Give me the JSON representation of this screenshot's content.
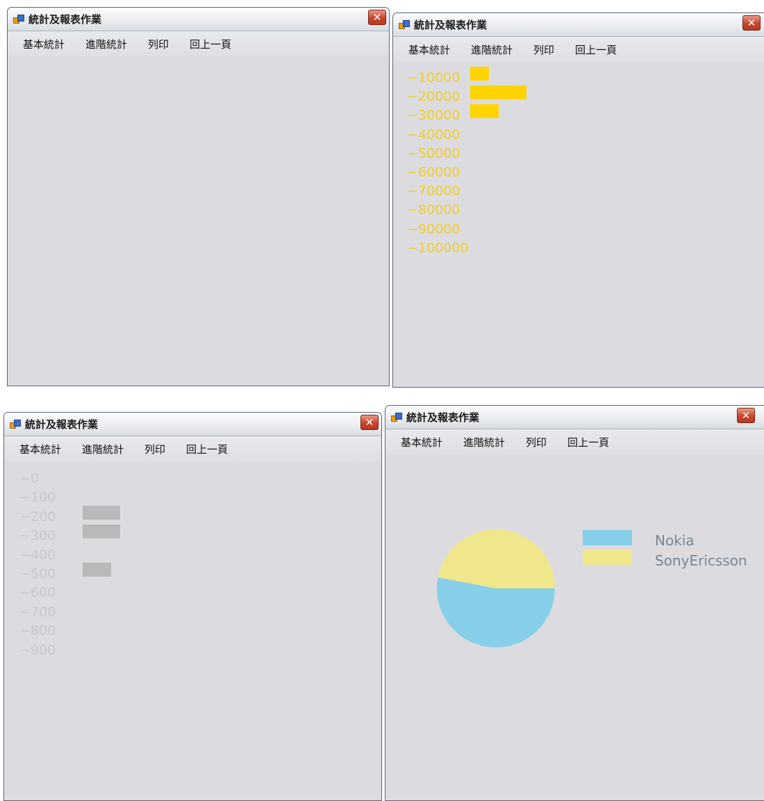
{
  "colors": {
    "yellow_bar": "#ffd400",
    "yellow_label": "#f2cc2a",
    "gray_bar": "#b9b9bb",
    "gray_label": "#c8c8cc",
    "nokia": "#87cfe9",
    "sonyericsson": "#f0e68c",
    "window_bg": "#dcdce0"
  },
  "windows": [
    {
      "title": "統計及報表作業",
      "close_glyph": "✕",
      "menu": [
        "基本統計",
        "進階統計",
        "列印",
        "回上一頁"
      ]
    },
    {
      "title": "統計及報表作業",
      "close_glyph": "✕",
      "menu": [
        "基本統計",
        "進階統計",
        "列印",
        "回上一頁"
      ],
      "chart_data": {
        "type": "bar",
        "orientation": "horizontal",
        "categories": [
          "~10000",
          "~20000",
          "~30000",
          "~40000",
          "~50000",
          "~60000",
          "~70000",
          "~80000",
          "~90000",
          "~100000"
        ],
        "values": [
          1,
          3,
          1.5,
          0,
          0,
          0,
          0,
          0,
          0,
          0
        ],
        "title": "",
        "xlabel": "",
        "ylabel": "",
        "grid": false
      }
    },
    {
      "title": "統計及報表作業",
      "close_glyph": "✕",
      "menu": [
        "基本統計",
        "進階統計",
        "列印",
        "回上一頁"
      ],
      "chart_data": {
        "type": "bar",
        "orientation": "horizontal",
        "categories": [
          "~0",
          "~100",
          "~200",
          "~300",
          "~400",
          "~500",
          "~600",
          "~700",
          "~800",
          "~900"
        ],
        "values": [
          0,
          0,
          2,
          2,
          0,
          1.5,
          0,
          0,
          0,
          0
        ],
        "title": "",
        "xlabel": "",
        "ylabel": "",
        "grid": false
      }
    },
    {
      "title": "統計及報表作業",
      "close_glyph": "✕",
      "menu": [
        "基本統計",
        "進階統計",
        "列印",
        "回上一頁"
      ],
      "chart_data": {
        "type": "pie",
        "slices": [
          {
            "label": "Nokia",
            "value": 53,
            "color": "#87cfe9"
          },
          {
            "label": "SonyEricsson",
            "value": 47,
            "color": "#f0e68c"
          }
        ],
        "legend": "right",
        "title": ""
      }
    }
  ]
}
